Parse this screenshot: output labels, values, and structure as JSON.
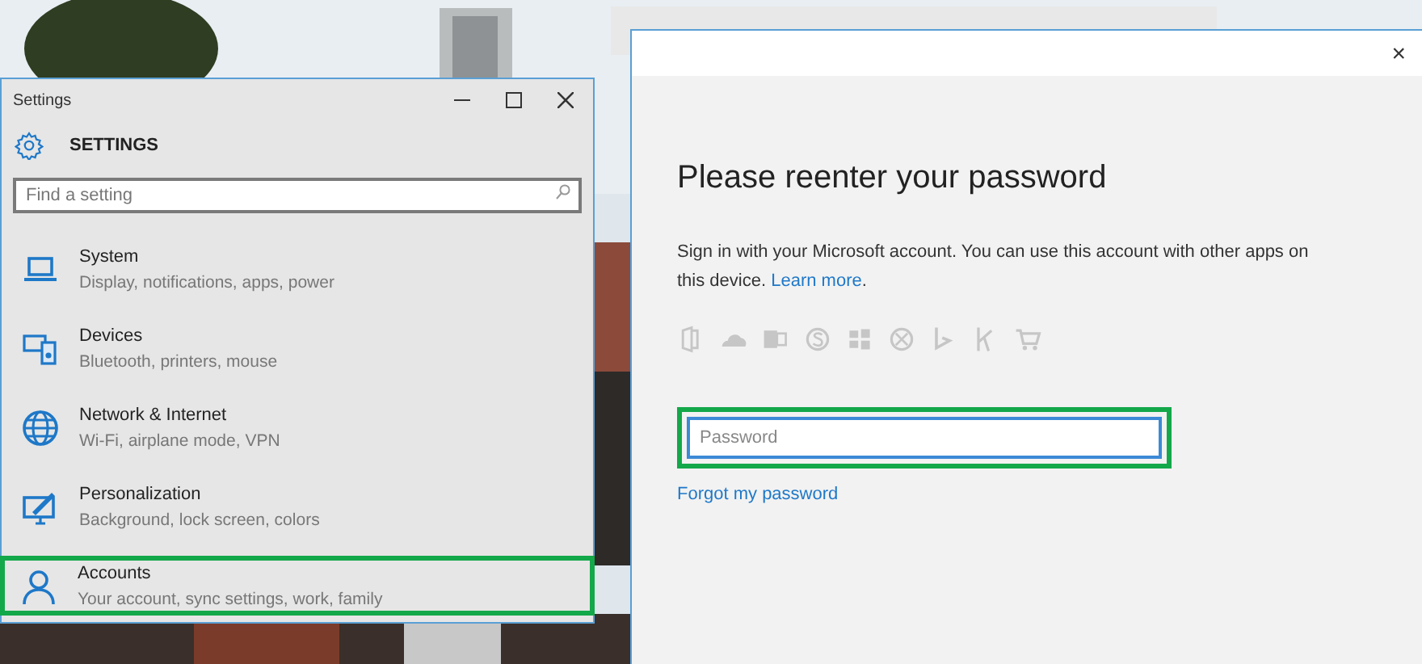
{
  "settings_window": {
    "title": "Settings",
    "heading": "SETTINGS",
    "search": {
      "placeholder": "Find a setting"
    },
    "items": [
      {
        "kind": "system",
        "title": "System",
        "subtitle": "Display, notifications, apps, power",
        "highlighted": false
      },
      {
        "kind": "devices",
        "title": "Devices",
        "subtitle": "Bluetooth, printers, mouse",
        "highlighted": false
      },
      {
        "kind": "network",
        "title": "Network & Internet",
        "subtitle": "Wi-Fi, airplane mode, VPN",
        "highlighted": false
      },
      {
        "kind": "personalization",
        "title": "Personalization",
        "subtitle": "Background, lock screen, colors",
        "highlighted": false
      },
      {
        "kind": "accounts",
        "title": "Accounts",
        "subtitle": "Your account, sync settings, work, family",
        "highlighted": true
      }
    ]
  },
  "dialog": {
    "close": "×",
    "heading": "Please reenter your password",
    "description": "Sign in with your Microsoft account. You can use this account with other apps on this device.",
    "learn_more": "Learn more",
    "after_link": ".",
    "password": {
      "placeholder": "Password",
      "highlighted": true
    },
    "forgot_link": "Forgot my password"
  }
}
